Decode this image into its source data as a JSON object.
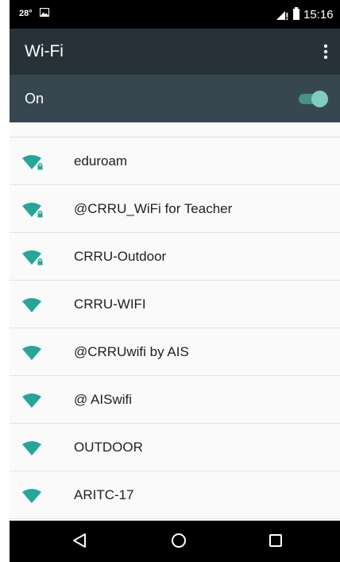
{
  "status_bar": {
    "temperature": "28°",
    "time": "15:16"
  },
  "app_bar": {
    "title": "Wi-Fi",
    "menu_icon": "more-vert-icon"
  },
  "wifi_switch": {
    "label": "On",
    "enabled": true,
    "accent_color": "#80cbc4"
  },
  "networks": [
    {
      "ssid": "eduroam",
      "secured": true
    },
    {
      "ssid": "@CRRU_WiFi for Teacher",
      "secured": true
    },
    {
      "ssid": "CRRU-Outdoor",
      "secured": true
    },
    {
      "ssid": "CRRU-WIFI",
      "secured": false
    },
    {
      "ssid": "@CRRUwifi by AIS",
      "secured": false
    },
    {
      "ssid": "@ AISwifi",
      "secured": false
    },
    {
      "ssid": "OUTDOOR",
      "secured": false
    },
    {
      "ssid": "ARITC-17",
      "secured": false
    }
  ],
  "nav_bar": {
    "icons": [
      "back-icon",
      "home-icon",
      "recents-icon"
    ]
  },
  "colors": {
    "status_bar": "#000000",
    "app_bar": "#263238",
    "switch_bar": "#37474f",
    "wifi_icon": "#26a69a"
  }
}
